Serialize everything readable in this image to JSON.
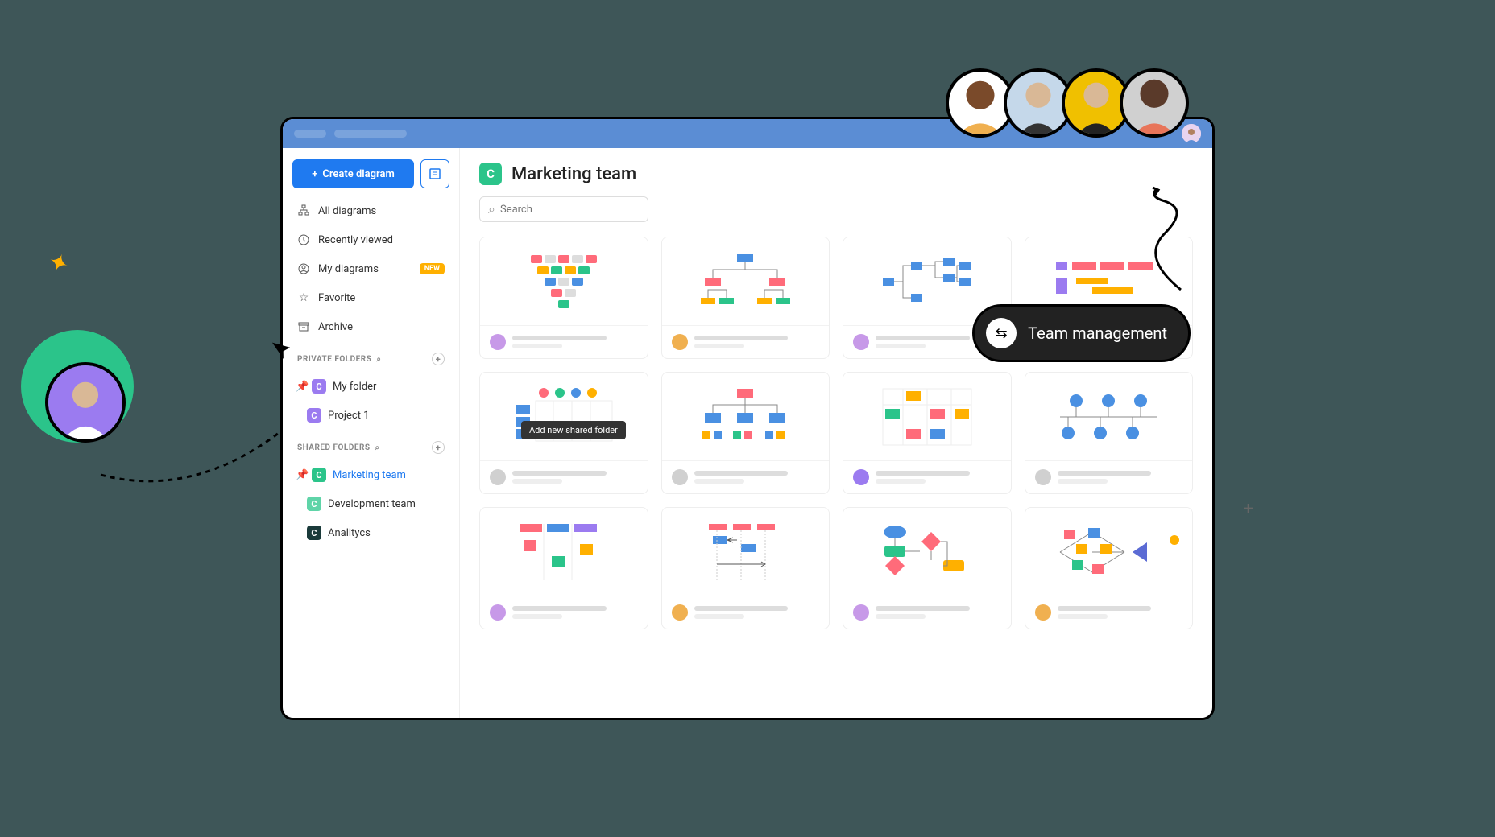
{
  "header": {
    "create_button": "Create diagram"
  },
  "nav": {
    "all": "All diagrams",
    "recent": "Recently viewed",
    "mine": "My diagrams",
    "mine_badge": "NEW",
    "favorite": "Favorite",
    "archive": "Archive"
  },
  "sections": {
    "private": "PRIVATE FOLDERS",
    "shared": "SHARED FOLDERS"
  },
  "private_folders": [
    {
      "label": "My folder",
      "color": "purple",
      "pinned": true
    },
    {
      "label": "Project 1",
      "color": "purple",
      "pinned": false
    }
  ],
  "shared_folders": [
    {
      "label": "Marketing team",
      "color": "teal",
      "pinned": true,
      "active": true
    },
    {
      "label": "Development team",
      "color": "teal-light",
      "pinned": false
    },
    {
      "label": "Analitycs",
      "color": "dark",
      "pinned": false
    }
  ],
  "tooltip": "Add new shared folder",
  "page": {
    "title": "Marketing team",
    "search_placeholder": "Search"
  },
  "overlay": {
    "team_management": "Team management"
  },
  "avatar_colors": {
    "small": "#e8d4f0",
    "card": [
      "#c799e8",
      "#f0b050",
      "#c799e8",
      "#f0b050",
      "#d0d0d0",
      "#d0d0d0",
      "#9b7bf0",
      "#d0d0d0",
      "#c799e8",
      "#f0b050",
      "#c799e8",
      "#f0b050"
    ],
    "big": [
      "#f0b050",
      "#c5d8ea",
      "#f0c000",
      "#e8755a"
    ],
    "side": "#9b7bf0"
  }
}
